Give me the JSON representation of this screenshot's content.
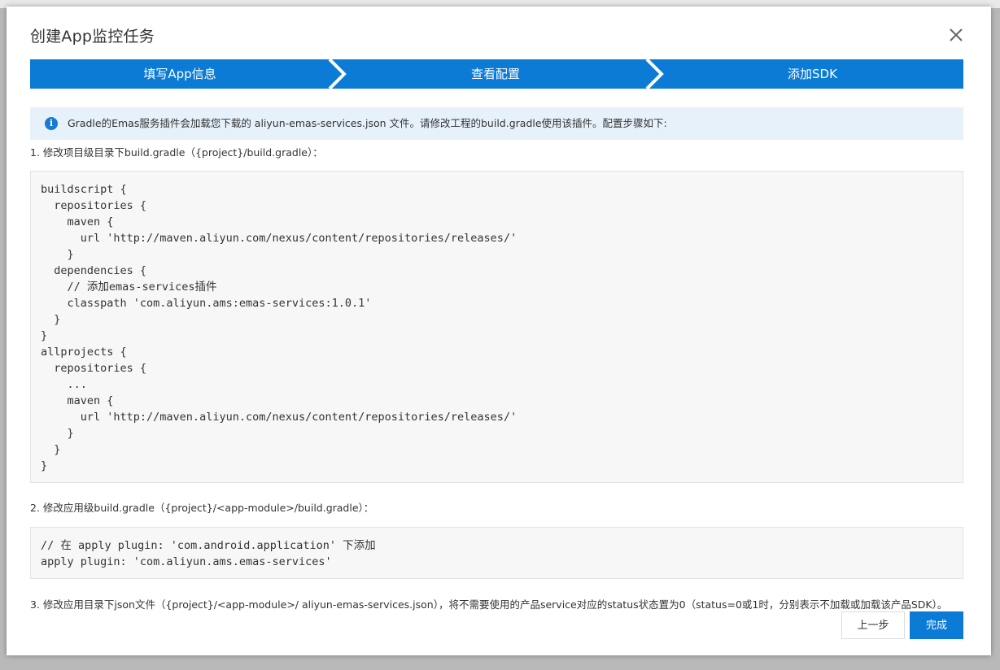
{
  "dialog": {
    "title": "创建App监控任务"
  },
  "steps": [
    {
      "label": "填写App信息"
    },
    {
      "label": "查看配置"
    },
    {
      "label": "添加SDK"
    }
  ],
  "colors": {
    "accent": "#0b7bd6",
    "notice_bg": "#e6f1fa",
    "code_bg": "#f7f7f7"
  },
  "notice": {
    "icon": "info-icon",
    "text": "Gradle的Emas服务插件会加载您下载的 aliyun-emas-services.json 文件。请修改工程的build.gradle使用该插件。配置步骤如下:"
  },
  "instructions": {
    "step1": "1. 修改项目级目录下build.gradle（{project}/build.gradle）：",
    "step1_code": "buildscript {\n  repositories {\n    maven {\n      url 'http://maven.aliyun.com/nexus/content/repositories/releases/'\n    }\n  dependencies {\n    // 添加emas-services插件\n    classpath 'com.aliyun.ams:emas-services:1.0.1'\n  }\n}\nallprojects {\n  repositories {\n    ...\n    maven {\n      url 'http://maven.aliyun.com/nexus/content/repositories/releases/'\n    }\n  }\n}",
    "step2": "2. 修改应用级build.gradle（{project}/<app-module>/build.gradle）：",
    "step2_code": "// 在 apply plugin: 'com.android.application' 下添加\napply plugin: 'com.aliyun.ams.emas-services'",
    "step3": "3. 修改应用目录下json文件（{project}/<app-module>/ aliyun-emas-services.json），将不需要使用的产品service对应的status状态置为0（status=0或1时，分别表示不加载或加载该产品SDK）。"
  },
  "footer": {
    "prev_label": "上一步",
    "done_label": "完成"
  }
}
